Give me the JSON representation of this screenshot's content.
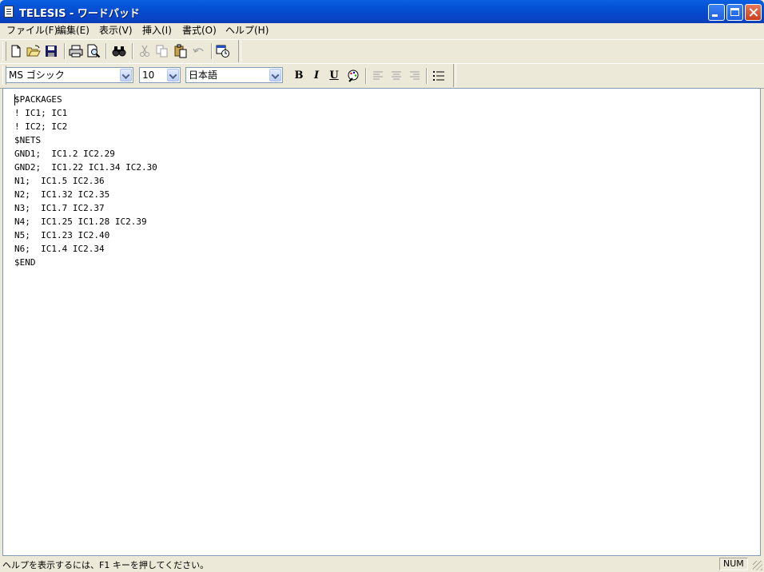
{
  "window": {
    "title": "TELESIS - ワードパッド"
  },
  "menu": {
    "items": [
      "ファイル(F)",
      "編集(E)",
      "表示(V)",
      "挿入(I)",
      "書式(O)",
      "ヘルプ(H)"
    ]
  },
  "toolbar": {
    "icons": [
      "new-document-icon",
      "open-folder-icon",
      "save-icon",
      "print-icon",
      "print-preview-icon",
      "find-icon",
      "cut-icon",
      "copy-icon",
      "paste-icon",
      "undo-icon",
      "insert-datetime-icon"
    ]
  },
  "format": {
    "font_name": "MS ゴシック",
    "font_size": "10",
    "script": "日本語",
    "bold_label": "B",
    "italic_label": "I",
    "underline_label": "U"
  },
  "document": {
    "lines": [
      "$PACKAGES",
      "! IC1; IC1",
      "! IC2; IC2",
      "$NETS",
      "GND1;  IC1.2 IC2.29",
      "GND2;  IC1.22 IC1.34 IC2.30",
      "N1;  IC1.5 IC2.36",
      "N2;  IC1.32 IC2.35",
      "N3;  IC1.7 IC2.37",
      "N4;  IC1.25 IC1.28 IC2.39",
      "N5;  IC1.23 IC2.40",
      "N6;  IC1.4 IC2.34",
      "$END"
    ]
  },
  "status": {
    "help_text": "ヘルプを表示するには、F1 キーを押してください。",
    "num_indicator": "NUM"
  }
}
